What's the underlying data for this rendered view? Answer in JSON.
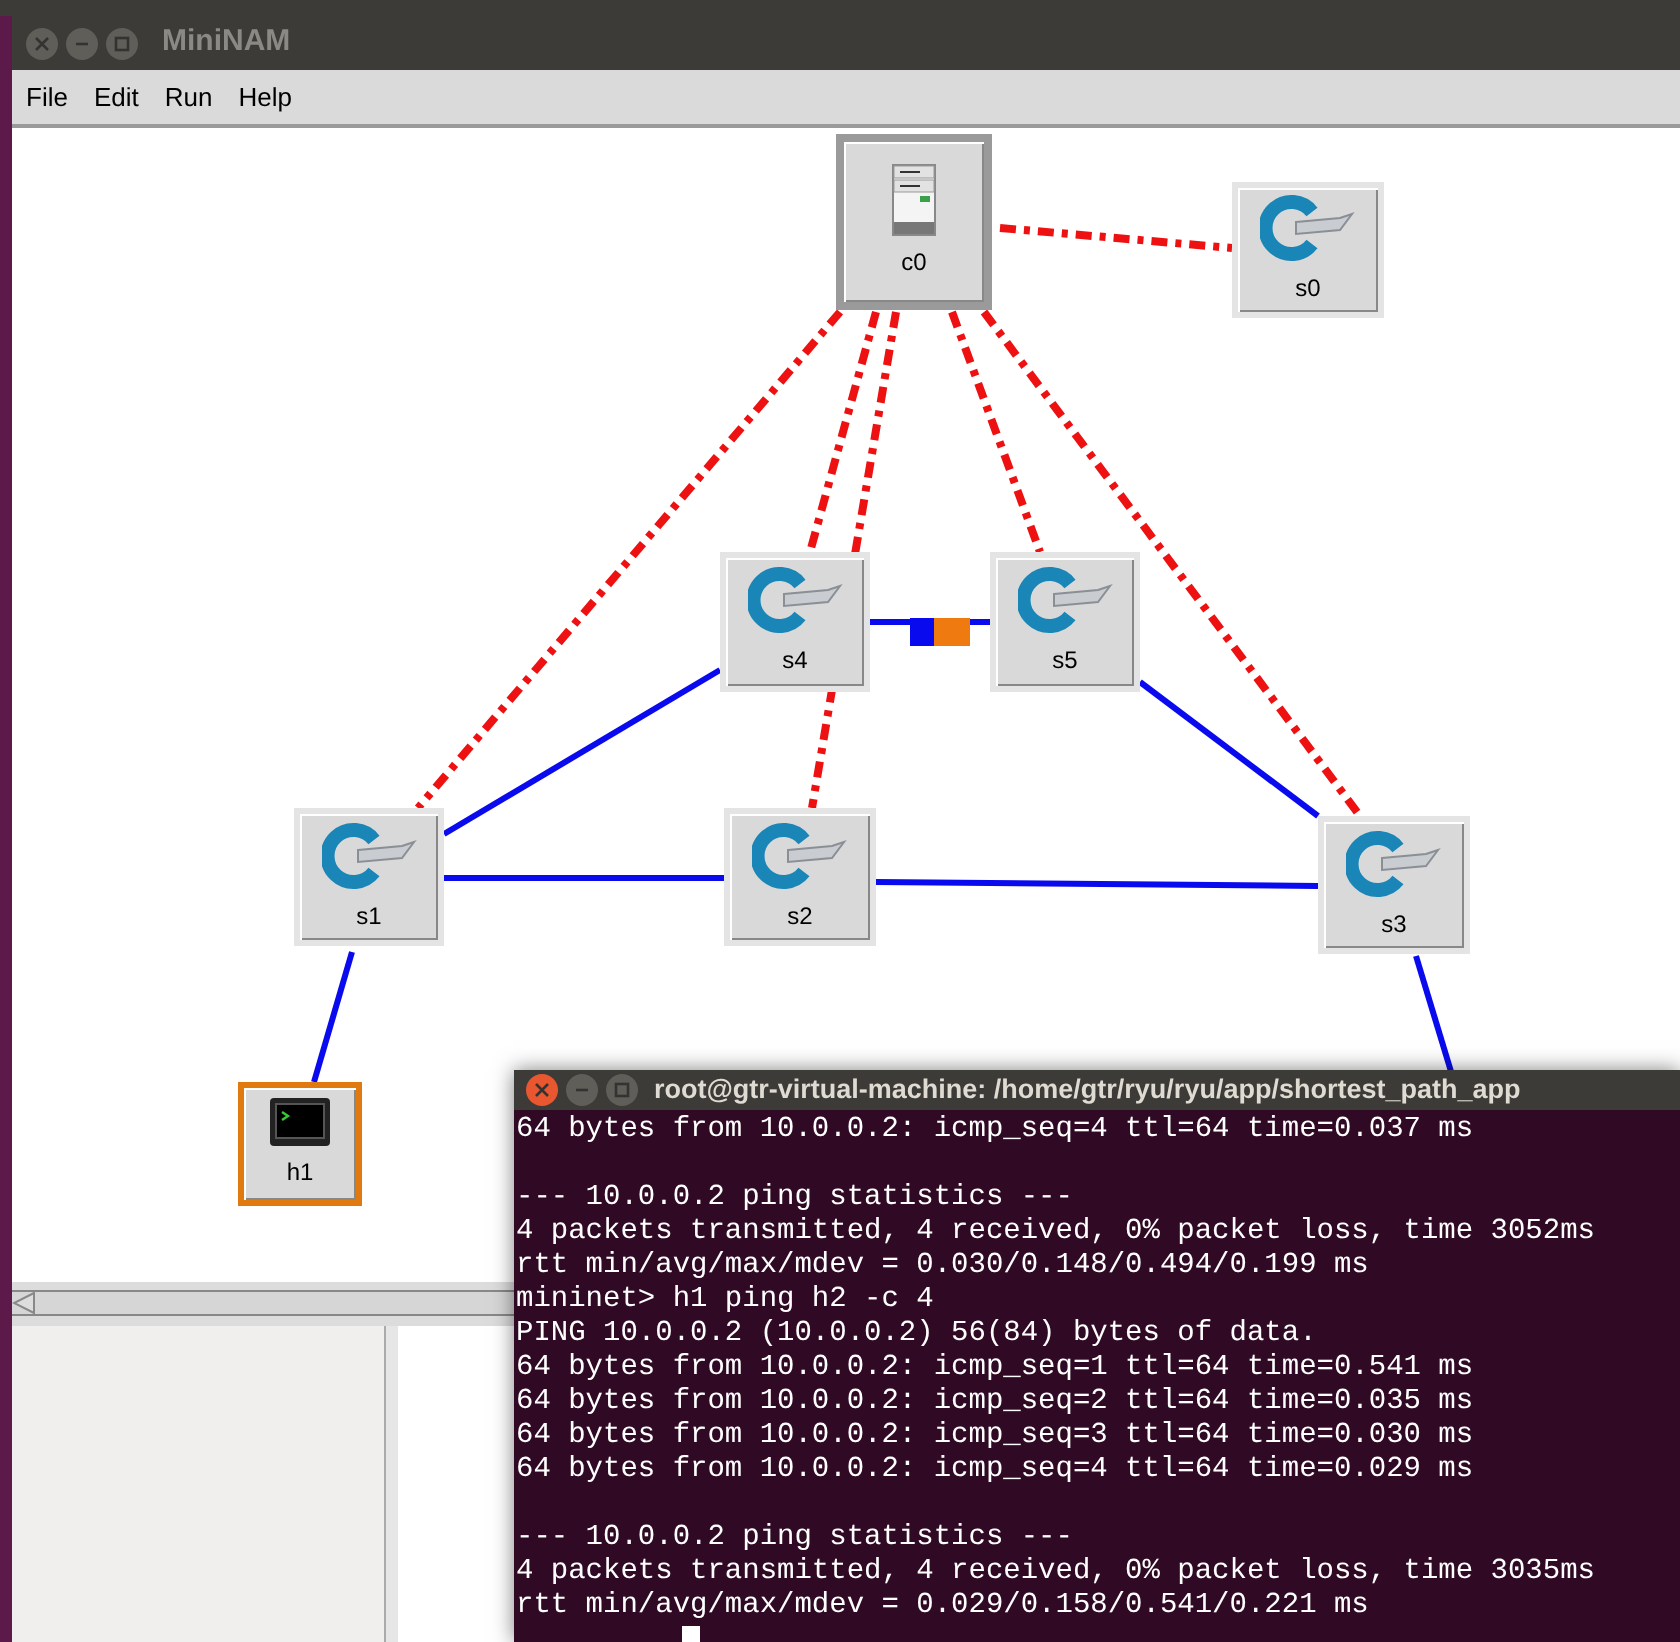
{
  "window": {
    "title": "MiniNAM"
  },
  "menu": [
    "File",
    "Edit",
    "Run",
    "Help"
  ],
  "nodes": [
    {
      "label": "c0",
      "kind": "controller",
      "selected": false
    },
    {
      "label": "s0",
      "kind": "switch",
      "selected": false
    },
    {
      "label": "s4",
      "kind": "switch",
      "selected": false
    },
    {
      "label": "s5",
      "kind": "switch",
      "selected": false
    },
    {
      "label": "s1",
      "kind": "switch",
      "selected": false
    },
    {
      "label": "s2",
      "kind": "switch",
      "selected": false
    },
    {
      "label": "s3",
      "kind": "switch",
      "selected": false
    },
    {
      "label": "h1",
      "kind": "host",
      "selected": true
    }
  ],
  "terminal": {
    "title": "root@gtr-virtual-machine: /home/gtr/ryu/ryu/app/shortest_path_app",
    "blocks": [
      [
        "64 bytes from 10.0.0.2: icmp_seq=4 ttl=64 time=0.037 ms"
      ],
      [
        "--- 10.0.0.2 ping statistics ---",
        "4 packets transmitted, 4 received, 0% packet loss, time 3052ms",
        "rtt min/avg/max/mdev = 0.030/0.148/0.494/0.199 ms",
        "mininet> h1 ping h2 -c 4",
        "PING 10.0.0.2 (10.0.0.2) 56(84) bytes of data.",
        "64 bytes from 10.0.0.2: icmp_seq=1 ttl=64 time=0.541 ms",
        "64 bytes from 10.0.0.2: icmp_seq=2 ttl=64 time=0.035 ms",
        "64 bytes from 10.0.0.2: icmp_seq=3 ttl=64 time=0.030 ms",
        "64 bytes from 10.0.0.2: icmp_seq=4 ttl=64 time=0.029 ms"
      ],
      [
        "--- 10.0.0.2 ping statistics ---",
        "4 packets transmitted, 4 received, 0% packet loss, time 3035ms",
        "rtt min/avg/max/mdev = 0.029/0.158/0.541/0.221 ms"
      ]
    ]
  }
}
